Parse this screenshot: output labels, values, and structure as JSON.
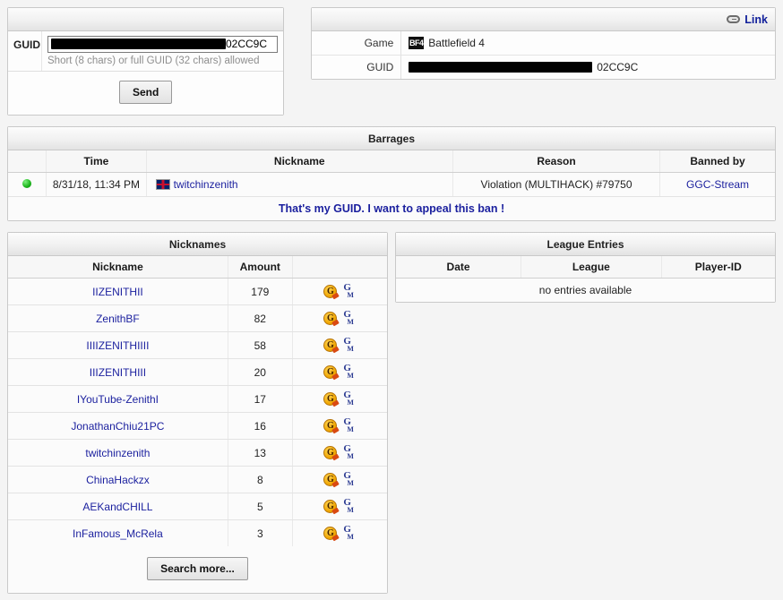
{
  "guid_form": {
    "label": "GUID",
    "value_suffix": "02CC9C",
    "redacted": true,
    "hint": "Short (8 chars) or full GUID (32 chars) allowed",
    "send_label": "Send"
  },
  "game_info": {
    "link_label": "Link",
    "rows": [
      {
        "key": "Game",
        "value": "Battlefield 4",
        "icon": "bf4-icon",
        "icon_text": "BF4"
      },
      {
        "key": "GUID",
        "value_suffix": "02CC9C",
        "redacted": true
      }
    ]
  },
  "barrages": {
    "title": "Barrages",
    "columns": [
      "",
      "Time",
      "Nickname",
      "Reason",
      "Banned by"
    ],
    "rows": [
      {
        "status": "online",
        "time": "8/31/18, 11:34 PM",
        "flag": "uk-flag-icon",
        "nickname": "twitchinzenith",
        "reason": "Violation (MULTIHACK) #79750",
        "banned_by": "GGC-Stream"
      }
    ],
    "appeal_text": "That's my GUID. I want to appeal this ban !"
  },
  "nicknames": {
    "title": "Nicknames",
    "columns": [
      "Nickname",
      "Amount",
      ""
    ],
    "rows": [
      {
        "nickname": "IIZENITHII",
        "amount": "179"
      },
      {
        "nickname": "ZenithBF",
        "amount": "82"
      },
      {
        "nickname": "IIIIZENITHIIII",
        "amount": "58"
      },
      {
        "nickname": "IIIZENITHIII",
        "amount": "20"
      },
      {
        "nickname": "IYouTube-ZenithI",
        "amount": "17"
      },
      {
        "nickname": "JonathanChiu21PC",
        "amount": "16"
      },
      {
        "nickname": "twitchinzenith",
        "amount": "13"
      },
      {
        "nickname": "ChinaHackzx",
        "amount": "8"
      },
      {
        "nickname": "AEKandCHILL",
        "amount": "5"
      },
      {
        "nickname": "InFamous_McRela",
        "amount": "3"
      }
    ],
    "search_more_label": "Search more...",
    "row_icons": {
      "gameme": "G",
      "gm_top": "G",
      "gm_bottom": "M"
    }
  },
  "league": {
    "title": "League Entries",
    "columns": [
      "Date",
      "League",
      "Player-ID"
    ],
    "empty_text": "no entries available",
    "rows": []
  },
  "colors": {
    "link": "#1a1f9e",
    "status_online": "#19b319",
    "accent_icon": "#f0a500",
    "page_bg": "#f4f4f4"
  }
}
